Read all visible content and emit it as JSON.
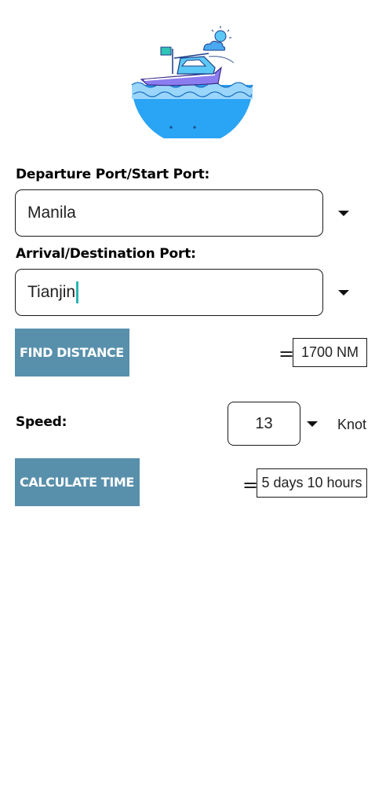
{
  "departure": {
    "label": "Departure Port/Start Port:",
    "value": "Manila"
  },
  "arrival": {
    "label": "Arrival/Destination Port:",
    "value": "Tianjin"
  },
  "distance": {
    "button_label": "FIND DISTANCE",
    "equals": "=",
    "result": "1700 NM"
  },
  "speed": {
    "label": "Speed:",
    "value": "13",
    "unit": "Knot"
  },
  "time": {
    "button_label": "CALCULATE TIME",
    "equals": "=",
    "result": "5 days 10 hours"
  },
  "icons": {
    "hero": "boat-illustration-icon",
    "dropdown": "triangle-down-icon"
  },
  "colors": {
    "button_bg": "#5890ac",
    "caret": "#2bb5b5",
    "sea": "#2aa4f4",
    "boat": "#8b7cf0"
  }
}
